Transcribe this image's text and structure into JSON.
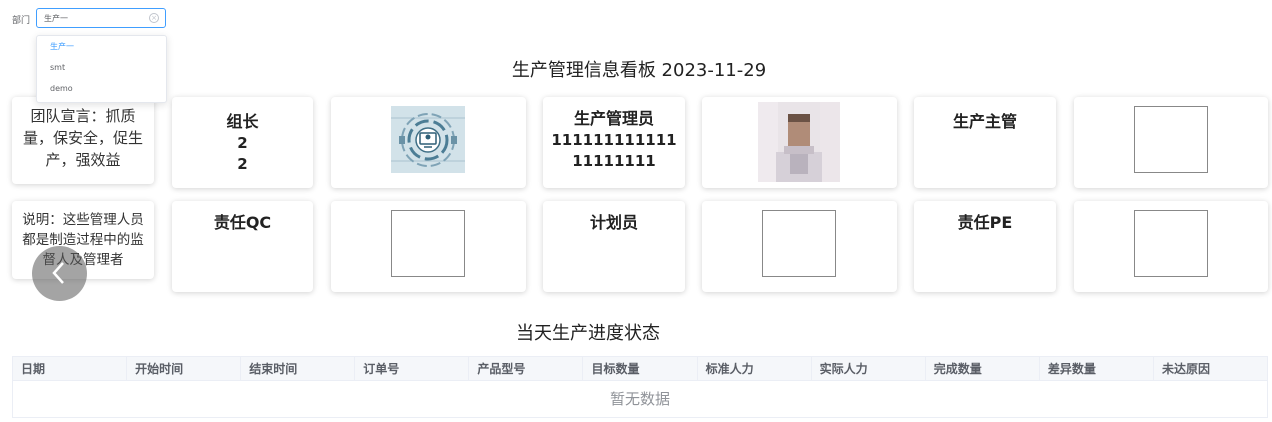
{
  "filter": {
    "label": "部门",
    "selected": "生产一",
    "options": [
      "生产一",
      "smt",
      "demo"
    ]
  },
  "board": {
    "title": "生产管理信息看板 2023-11-29"
  },
  "cards": {
    "motto": "团队宣言：抓质量，保安全，促生产，强效益",
    "note": "说明：这些管理人员都是制造过程中的监督人及管理者",
    "group_leader": {
      "role": "组长",
      "line1": "2",
      "line2": "2"
    },
    "production_admin": {
      "role": "生产管理员",
      "line1": "111111111111",
      "line2": "11111111"
    },
    "production_supervisor": {
      "role": "生产主管"
    },
    "qc": {
      "role": "责任QC"
    },
    "planner": {
      "role": "计划员"
    },
    "pe": {
      "role": "责任PE"
    }
  },
  "progress": {
    "title": "当天生产进度状态",
    "columns": [
      "日期",
      "开始时间",
      "结束时间",
      "订单号",
      "产品型号",
      "目标数量",
      "标准人力",
      "实际人力",
      "完成数量",
      "差异数量",
      "未达原因"
    ],
    "empty_text": "暂无数据"
  }
}
